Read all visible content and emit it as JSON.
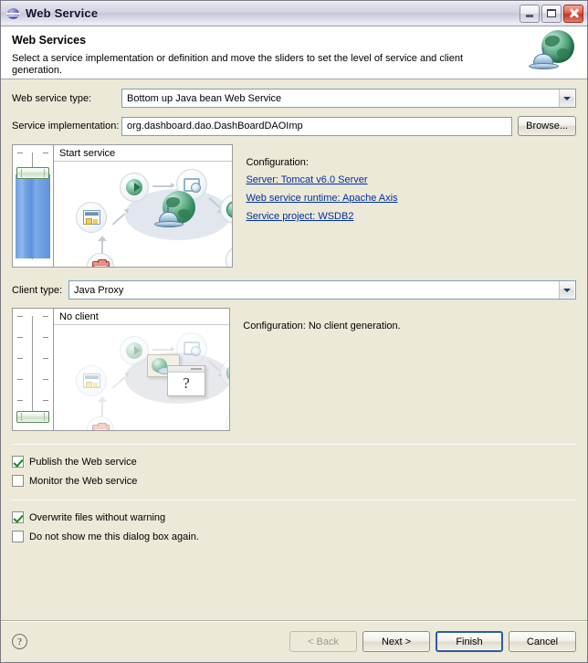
{
  "window": {
    "title": "Web Service",
    "minimize_label": "Minimize",
    "maximize_label": "Maximize",
    "close_label": "Close"
  },
  "banner": {
    "heading": "Web Services",
    "description": "Select a service implementation or definition and move the sliders to set the level of service and client generation."
  },
  "form": {
    "web_service_type_label": "Web service type:",
    "web_service_type_value": "Bottom up Java bean Web Service",
    "service_implementation_label": "Service implementation:",
    "service_implementation_value": "org.dashboard.dao.DashBoardDAOImp",
    "browse_label": "Browse...",
    "client_type_label": "Client type:",
    "client_type_value": "Java Proxy"
  },
  "service_panel": {
    "stage_title": "Start service",
    "slider_position": "start-service",
    "slider_ticks": 6,
    "configuration_heading": "Configuration:",
    "links": [
      "Server: Tomcat v6.0 Server",
      "Web service runtime: Apache Axis",
      "Service project: WSDB2"
    ]
  },
  "client_panel": {
    "stage_title": "No client",
    "slider_position": "no-client",
    "slider_ticks": 6,
    "configuration_text": "Configuration: No client generation."
  },
  "options": [
    {
      "label": "Publish the Web service",
      "checked": true
    },
    {
      "label": "Monitor the Web service",
      "checked": false
    }
  ],
  "options2": [
    {
      "label": "Overwrite files without warning",
      "checked": true
    },
    {
      "label": "Do not show me this dialog box again.",
      "checked": false
    }
  ],
  "buttons": {
    "help": "?",
    "back": "< Back",
    "next": "Next >",
    "finish": "Finish",
    "cancel": "Cancel"
  },
  "colors": {
    "link": "#00309c",
    "dialog_bg": "#ece9d8",
    "slider_fill": "#6f9fe0",
    "check": "#108a21",
    "default_button_border": "#2a5ca8"
  }
}
